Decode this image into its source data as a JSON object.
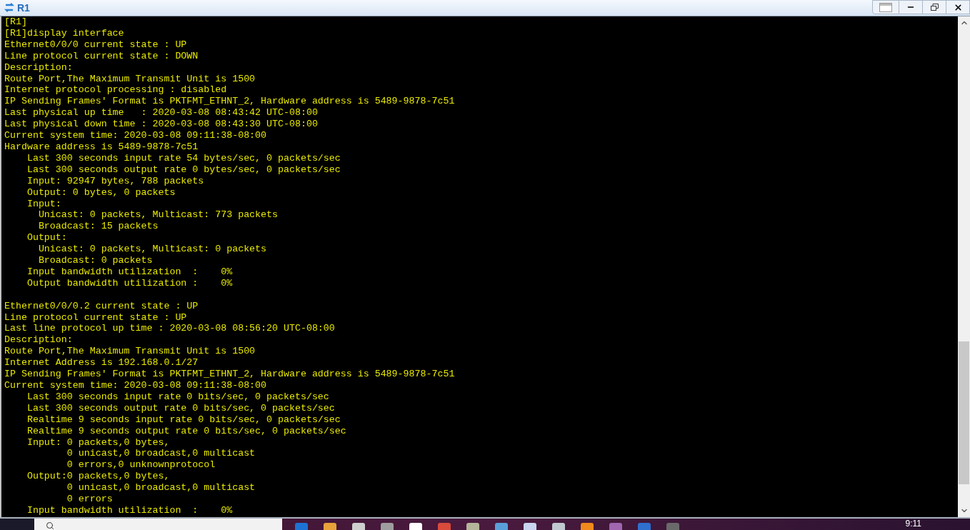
{
  "window": {
    "title": "R1"
  },
  "terminal": {
    "blocks": [
      [
        "[R1]",
        "[R1]display interface",
        "Ethernet0/0/0 current state : UP",
        "Line protocol current state : DOWN",
        "Description:",
        "Route Port,The Maximum Transmit Unit is 1500",
        "Internet protocol processing : disabled",
        "IP Sending Frames' Format is PKTFMT_ETHNT_2, Hardware address is 5489-9878-7c51",
        "Last physical up time   : 2020-03-08 08:43:42 UTC-08:00",
        "Last physical down time : 2020-03-08 08:43:30 UTC-08:00",
        "Current system time: 2020-03-08 09:11:38-08:00",
        "Hardware address is 5489-9878-7c51",
        "    Last 300 seconds input rate 54 bytes/sec, 0 packets/sec",
        "    Last 300 seconds output rate 0 bytes/sec, 0 packets/sec",
        "    Input: 92947 bytes, 788 packets",
        "    Output: 0 bytes, 0 packets",
        "    Input:",
        "      Unicast: 0 packets, Multicast: 773 packets",
        "      Broadcast: 15 packets",
        "    Output:",
        "      Unicast: 0 packets, Multicast: 0 packets",
        "      Broadcast: 0 packets",
        "    Input bandwidth utilization  :    0%",
        "    Output bandwidth utilization :    0%"
      ],
      [
        "Ethernet0/0/0.2 current state : UP",
        "Line protocol current state : UP",
        "Last line protocol up time : 2020-03-08 08:56:20 UTC-08:00",
        "Description:",
        "Route Port,The Maximum Transmit Unit is 1500",
        "Internet Address is 192.168.0.1/27",
        "IP Sending Frames' Format is PKTFMT_ETHNT_2, Hardware address is 5489-9878-7c51",
        "Current system time: 2020-03-08 09:11:38-08:00",
        "    Last 300 seconds input rate 0 bits/sec, 0 packets/sec",
        "    Last 300 seconds output rate 0 bits/sec, 0 packets/sec",
        "    Realtime 9 seconds input rate 0 bits/sec, 0 packets/sec",
        "    Realtime 9 seconds output rate 0 bits/sec, 0 packets/sec",
        "    Input: 0 packets,0 bytes,",
        "           0 unicast,0 broadcast,0 multicast",
        "           0 errors,0 unknownprotocol",
        "    Output:0 packets,0 bytes,",
        "           0 unicast,0 broadcast,0 multicast",
        "           0 errors",
        "    Input bandwidth utilization  :    0%"
      ]
    ]
  },
  "taskbar": {
    "clock": "9:11"
  }
}
